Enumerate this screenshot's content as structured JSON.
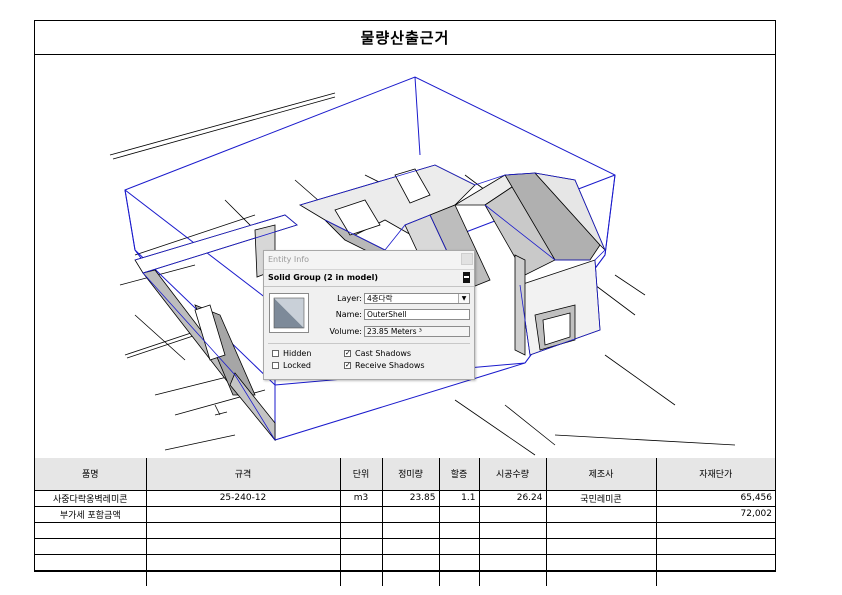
{
  "title": "물량산출근거",
  "entity_info": {
    "window_title": "Entity Info",
    "header": "Solid Group (2 in model)",
    "layer_label": "Layer:",
    "layer_value": "4층다락",
    "name_label": "Name:",
    "name_value": "OuterShell",
    "volume_label": "Volume:",
    "volume_value": "23.85 Meters ³",
    "hidden_label": "Hidden",
    "locked_label": "Locked",
    "cast_shadows_label": "Cast Shadows",
    "receive_shadows_label": "Receive Shadows",
    "hidden": false,
    "locked": false,
    "cast_shadows": true,
    "receive_shadows": true
  },
  "table": {
    "headers": [
      "품명",
      "규격",
      "단위",
      "정미량",
      "할증",
      "시공수량",
      "제조사",
      "자재단가"
    ],
    "rows": [
      [
        "사중다락옹벽레미콘",
        "25-240-12",
        "m3",
        "23.85",
        "1.1",
        "26.24",
        "국민레미콘",
        "65,456"
      ],
      [
        "부가세 포함금액",
        "",
        "",
        "",
        "",
        "",
        "",
        "72,002"
      ],
      [
        "",
        "",
        "",
        "",
        "",
        "",
        "",
        ""
      ],
      [
        "",
        "",
        "",
        "",
        "",
        "",
        "",
        ""
      ],
      [
        "",
        "",
        "",
        "",
        "",
        "",
        "",
        ""
      ],
      [
        "",
        "",
        "",
        "",
        "",
        "",
        "",
        ""
      ]
    ]
  }
}
